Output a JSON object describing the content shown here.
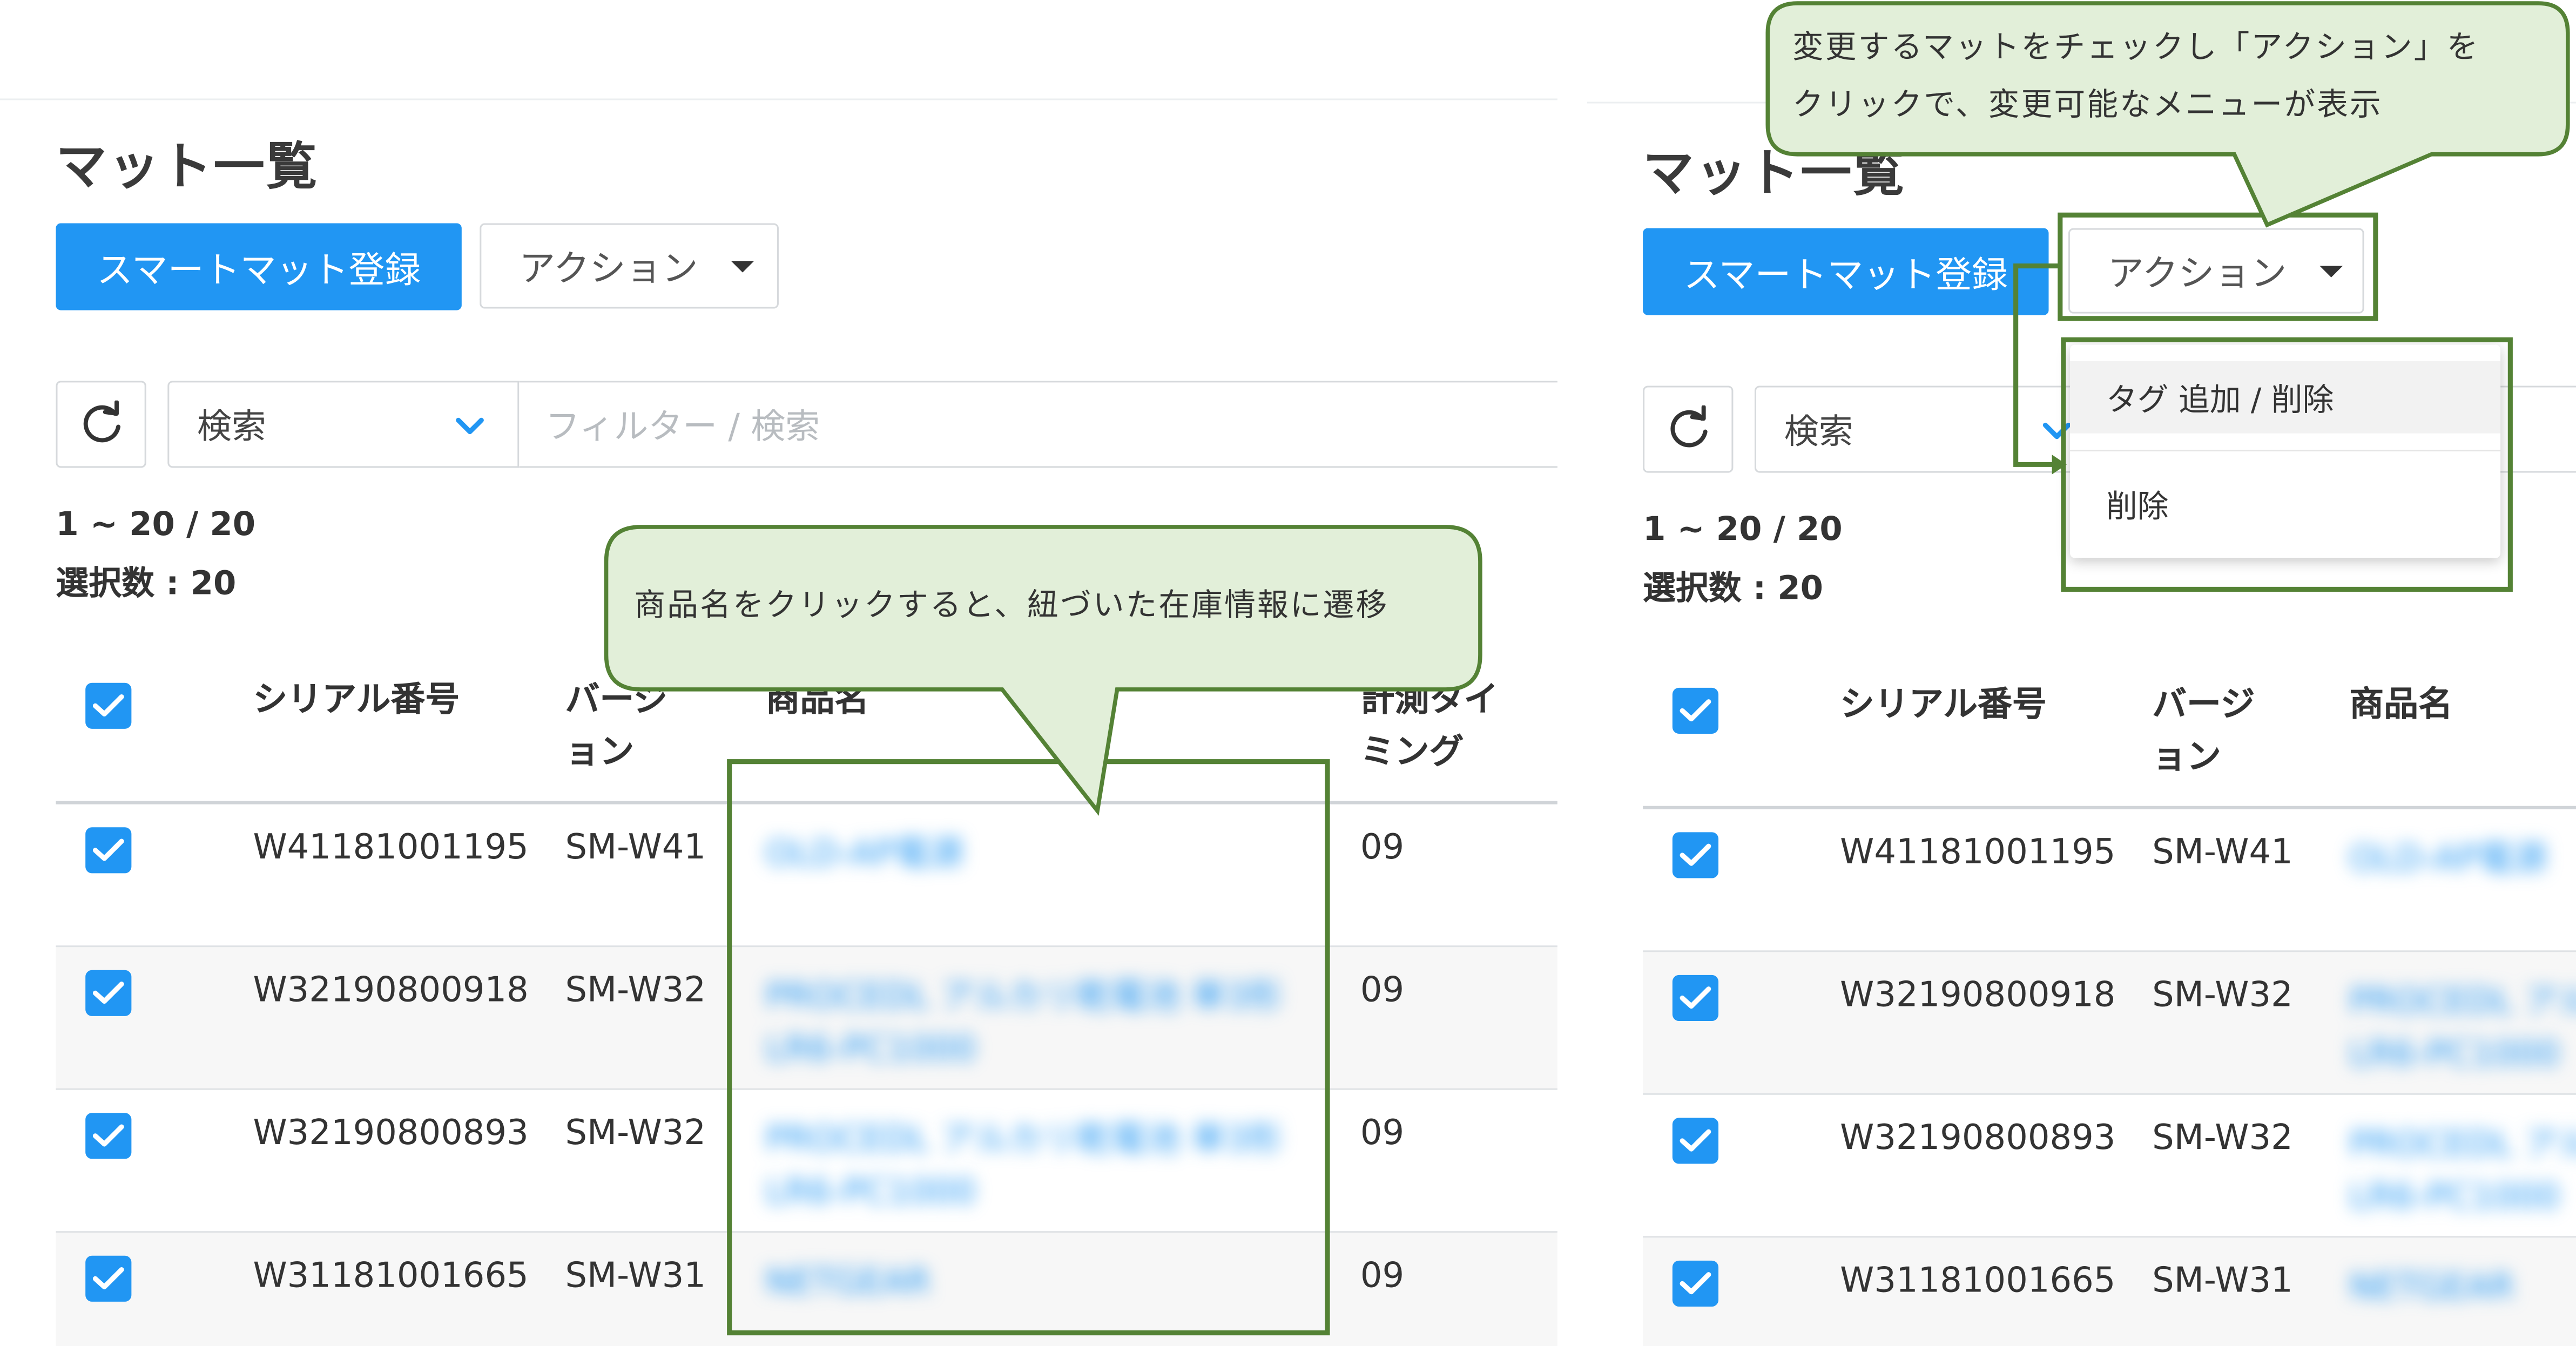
{
  "page": {
    "title": "マット一覧",
    "register_button": "スマートマット登録",
    "action_button": "アクション",
    "search_select": "検索",
    "filter_placeholder": "フィルター / 検索",
    "range": "1 ~ 20 / 20",
    "selected": "選択数 : 20",
    "columns": {
      "serial": "シリアル番号",
      "version_l1": "バージ",
      "version_l2": "ョン",
      "product": "商品名",
      "timing_l1": "計測タイ",
      "timing_l2": "ミング"
    },
    "rows": [
      {
        "serial": "W41181001195",
        "version": "SM-W41",
        "product_l1": "OLD-AP電源",
        "product_l2": "",
        "timing": "09"
      },
      {
        "serial": "W32190800918",
        "version": "SM-W32",
        "product_l1": "PROCEDL アルカリ乾電池 単3形",
        "product_l2": "LR6-PC1000",
        "timing": "09"
      },
      {
        "serial": "W32190800893",
        "version": "SM-W32",
        "product_l1": "PROCEDL アルカリ乾電池 単3形",
        "product_l2": "LR6-PC1000",
        "timing": "09"
      },
      {
        "serial": "W31181001665",
        "version": "SM-W31",
        "product_l1": "NETGEAR",
        "product_l2": "",
        "timing": "09"
      }
    ]
  },
  "dropdown": {
    "items": [
      "タグ 追加 / 削除",
      "削除"
    ]
  },
  "callouts": {
    "left": "商品名をクリックすると、紐づいた在庫情報に遷移",
    "right_line1": "変更するマットをチェックし「アクション」を",
    "right_line2": "クリックで、変更可能なメニューが表示"
  },
  "colors": {
    "primary": "#2196f3",
    "callout_fill": "#e2efd9",
    "callout_border": "#548235",
    "highlight_border": "#548235"
  }
}
